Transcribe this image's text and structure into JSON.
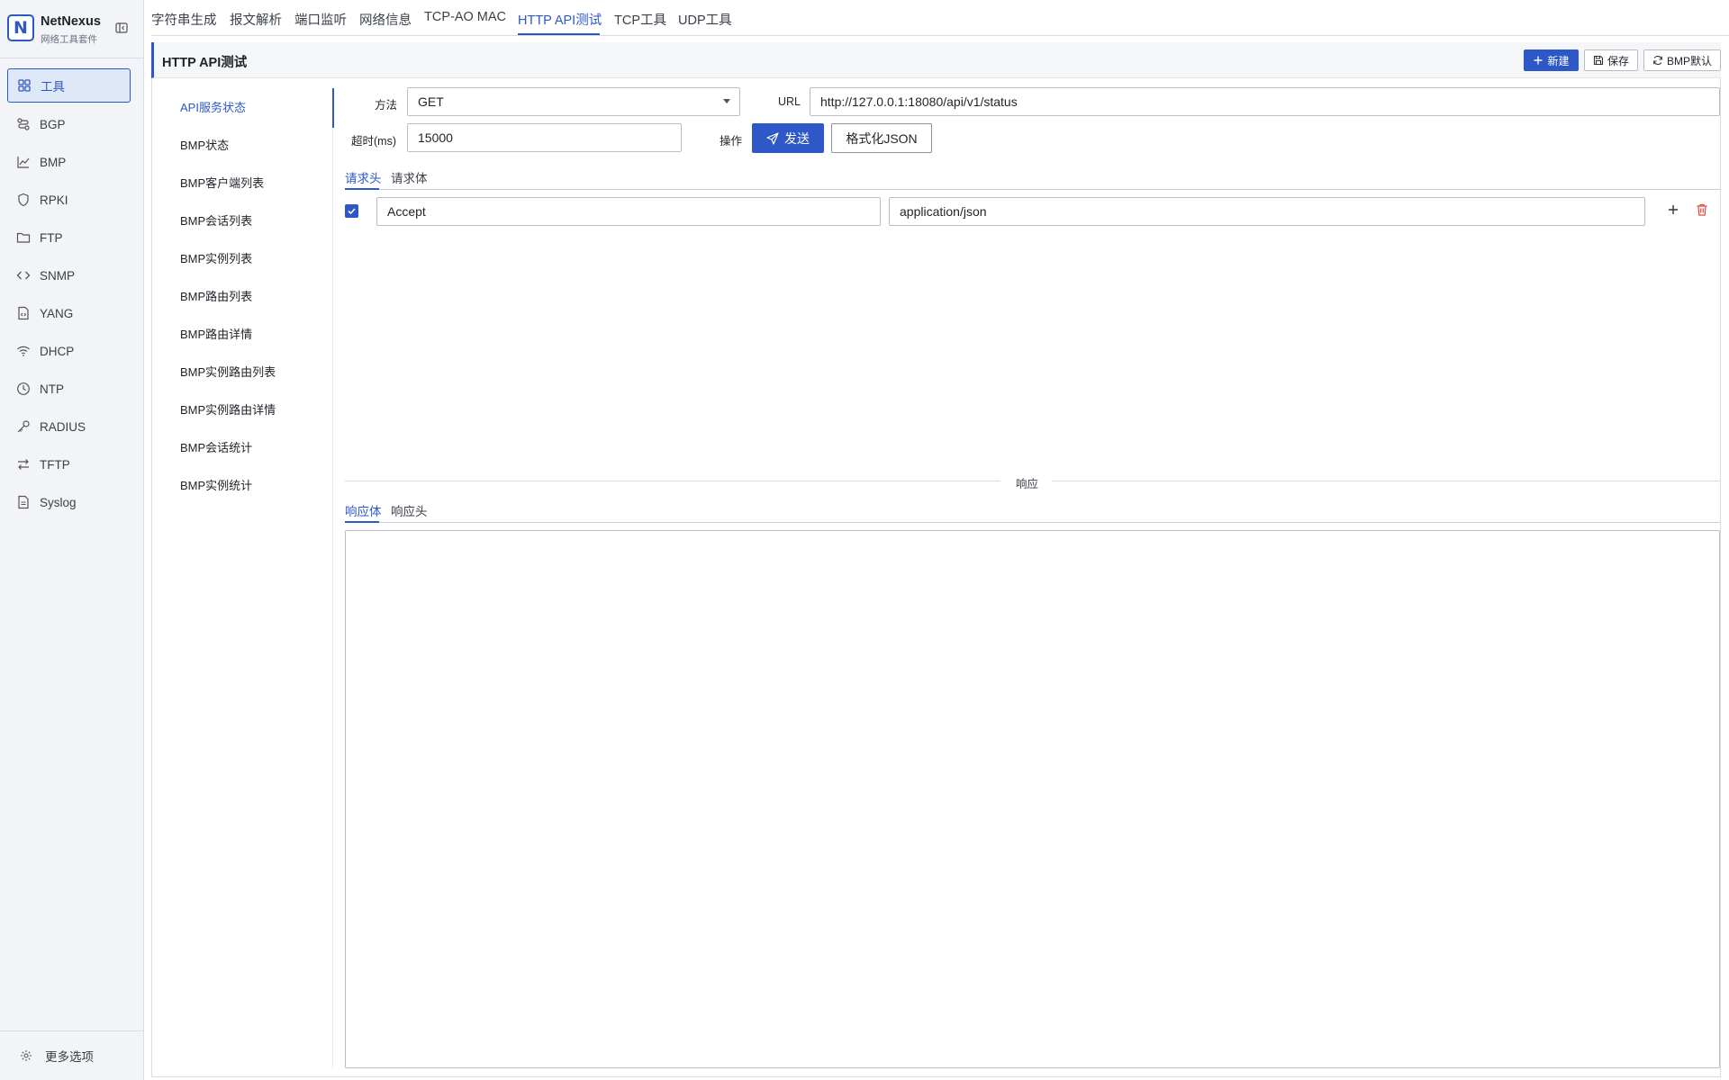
{
  "app": {
    "logo_letter": "N",
    "name": "NetNexus",
    "subtitle": "网络工具套件"
  },
  "sidebar": {
    "items": [
      {
        "label": "工具",
        "icon": "grid-icon"
      },
      {
        "label": "BGP",
        "icon": "route-icon"
      },
      {
        "label": "BMP",
        "icon": "chart-icon"
      },
      {
        "label": "RPKI",
        "icon": "shield-icon"
      },
      {
        "label": "FTP",
        "icon": "folder-icon"
      },
      {
        "label": "SNMP",
        "icon": "code-icon"
      },
      {
        "label": "YANG",
        "icon": "file-code-icon"
      },
      {
        "label": "DHCP",
        "icon": "wifi-icon"
      },
      {
        "label": "NTP",
        "icon": "clock-icon"
      },
      {
        "label": "RADIUS",
        "icon": "key-icon"
      },
      {
        "label": "TFTP",
        "icon": "transfer-icon"
      },
      {
        "label": "Syslog",
        "icon": "document-icon"
      }
    ],
    "more_options": "更多选项"
  },
  "top_tabs": [
    "字符串生成",
    "报文解析",
    "端口监听",
    "网络信息",
    "TCP-AO MAC",
    "HTTP API测试",
    "TCP工具",
    "UDP工具"
  ],
  "panel": {
    "title": "HTTP API测试",
    "buttons": {
      "new": "新建",
      "save": "保存",
      "bmp_default": "BMP默认"
    }
  },
  "api_list": [
    "API服务状态",
    "BMP状态",
    "BMP客户端列表",
    "BMP会话列表",
    "BMP实例列表",
    "BMP路由列表",
    "BMP路由详情",
    "BMP实例路由列表",
    "BMP实例路由详情",
    "BMP会话统计",
    "BMP实例统计"
  ],
  "form": {
    "method_label": "方法",
    "method_value": "GET",
    "url_label": "URL",
    "url_value": "http://127.0.0.1:18080/api/v1/status",
    "timeout_label": "超时(ms)",
    "timeout_value": "15000",
    "action_label": "操作",
    "send_button": "发送",
    "format_json_button": "格式化JSON"
  },
  "request_tabs": [
    "请求头",
    "请求体"
  ],
  "headers": [
    {
      "enabled": true,
      "key": "Accept",
      "value": "application/json"
    }
  ],
  "response": {
    "divider_label": "响应",
    "tabs": [
      "响应体",
      "响应头"
    ],
    "body": ""
  },
  "colors": {
    "accent": "#2e57c7",
    "danger": "#e04a3a"
  }
}
